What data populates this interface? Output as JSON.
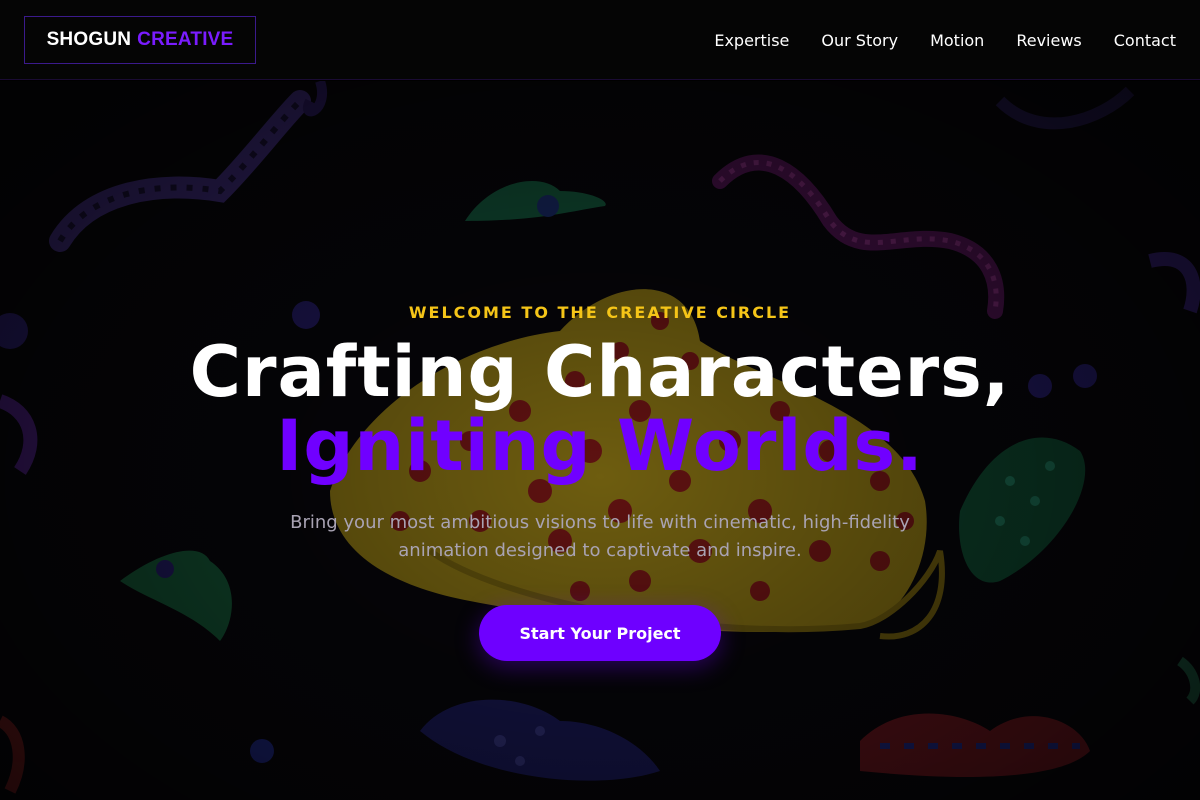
{
  "header": {
    "logo": {
      "part1": "SHOGUN",
      "part2": "CREATIVE"
    },
    "nav": [
      {
        "label": "Expertise"
      },
      {
        "label": "Our Story"
      },
      {
        "label": "Motion"
      },
      {
        "label": "Reviews"
      },
      {
        "label": "Contact"
      }
    ]
  },
  "hero": {
    "eyebrow": "WELCOME TO THE CREATIVE CIRCLE",
    "headline_line1": "Crafting Characters,",
    "headline_line2": "Igniting Worlds.",
    "subtitle": "Bring your most ambitious visions to life with cinematic, high-fidelity animation designed to captivate and inspire.",
    "cta_label": "Start Your Project",
    "background_image": "colorful polka-dot clay creatures on black"
  },
  "colors": {
    "accent_purple": "#6e00ff",
    "eyebrow_yellow": "#f5c518",
    "background": "#000000"
  }
}
